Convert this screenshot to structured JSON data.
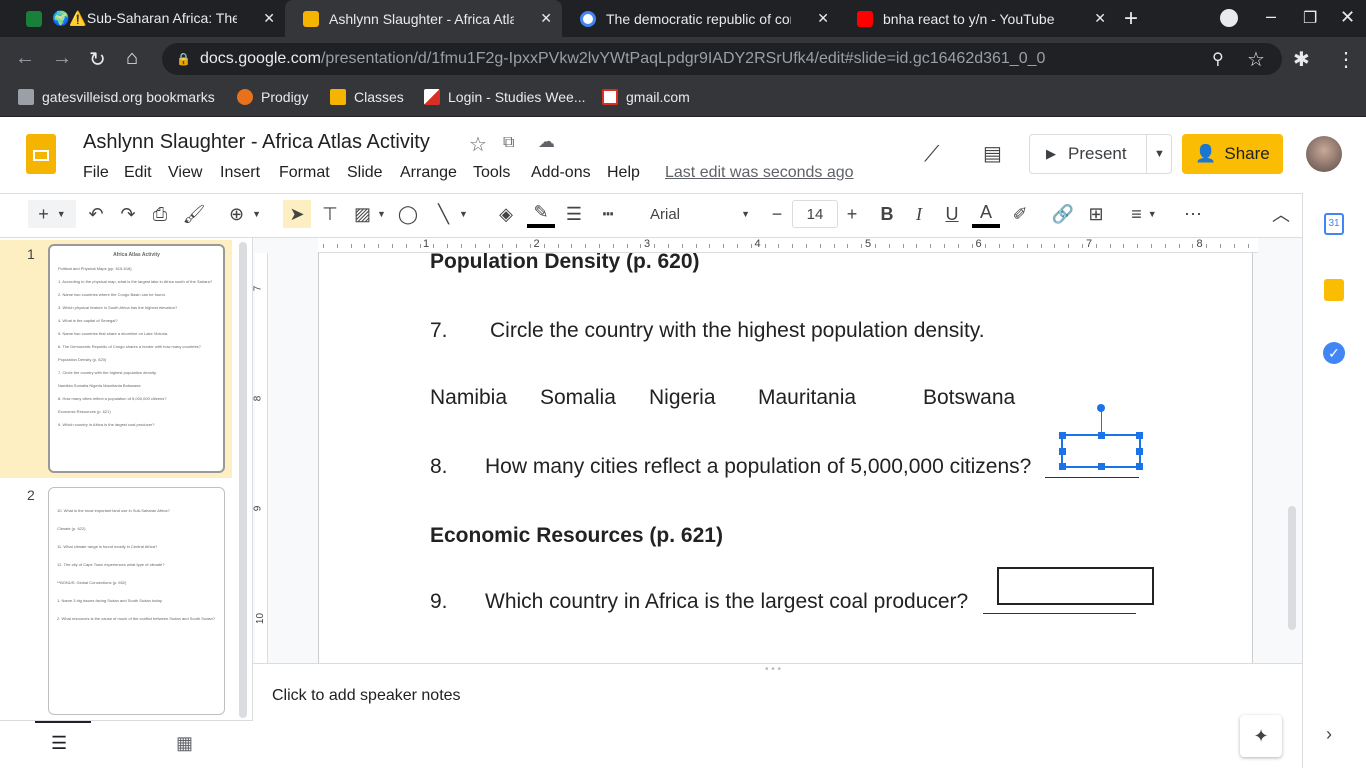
{
  "browser": {
    "tabs": [
      {
        "title": "🌍⚠️Sub-Saharan Africa: Thematic",
        "favicon_color": "#188038"
      },
      {
        "title": "Ashlynn Slaughter - Africa Atlas Activity",
        "favicon_color": "#f4b400",
        "active": true
      },
      {
        "title": "The democratic republic of congo",
        "favicon_color": "#4285f4"
      },
      {
        "title": "bnha react to y/n - YouTube",
        "favicon_color": "#ff0000"
      }
    ],
    "url_host": "docs.google.com",
    "url_path": "/presentation/d/1fmu1F2g-IpxxPVkw2lvYWtPaqLpdgr9IADY2RSrUfk4/edit#slide=id.gc16462d361_0_0",
    "bookmarks": [
      "gatesvilleisd.org bookmarks",
      "Prodigy",
      "Classes",
      "Login - Studies Wee...",
      "gmail.com"
    ]
  },
  "app": {
    "title": "Ashlynn Slaughter - Africa Atlas Activity",
    "menu": [
      "File",
      "Edit",
      "View",
      "Insert",
      "Format",
      "Slide",
      "Arrange",
      "Tools",
      "Add-ons",
      "Help"
    ],
    "last_edit": "Last edit was seconds ago",
    "present_label": "Present",
    "share_label": "Share",
    "font": "Arial",
    "font_size": "14"
  },
  "filmstrip": {
    "slides": [
      {
        "number": "1",
        "lines": [
          "Africa Atlas Activity",
          "Political and Physical Maps (pp. 615-618)",
          "1. According to the physical map, what is the largest lake in Africa south of the Sahara?",
          "2. Name two countries where the Congo Basin can be found.",
          "3. Which physical feature in South Africa has the highest elevation?",
          "4. What is the capital of Senegal?",
          "5. Name two countries that share a shoreline on Lake Victoria.",
          "6. The Democratic Republic of Congo shares a border with how many countries?",
          "Population Density (p. 620)",
          "7. Circle the country with the highest population density.",
          "Namibia  Somalia  Nigeria  Mauritania  Botswana",
          "8. How many cities reflect a population of 5,000,000 citizens?",
          "Economic Resources (p. 621)",
          "9. Which country in Africa is the largest coal producer?"
        ]
      },
      {
        "number": "2",
        "lines": [
          "10. What is the most important land use in Sub-Saharan Africa?",
          "Climate (p. 622)",
          "11. What climate range is found mostly in Central Africa?",
          "12. The city of Cape Town experiences what type of climate?",
          "**BONUS: Global Connections (p. 652)",
          "1. Name 3 big issues facing Sudan and South Sudan today.",
          "2. What resources is the cause of much of the conflict between Sudan and South Sudan?"
        ]
      }
    ]
  },
  "ruler": {
    "h": [
      "1",
      "2",
      "3",
      "4",
      "5",
      "6",
      "7",
      "8"
    ],
    "v": [
      "7",
      "8",
      "9",
      "10"
    ]
  },
  "slide": {
    "heading1": "Population Density (p. 620)",
    "q7_num": "7.",
    "q7_text": "Circle the country with the highest population density.",
    "countries": [
      "Namibia",
      "Somalia",
      "Nigeria",
      "Mauritania",
      "Botswana"
    ],
    "q8_num": "8.",
    "q8_text": "How many cities reflect a population of 5,000,000 citizens?",
    "heading2": "Economic Resources (p. 621)",
    "q9_num": "9.",
    "q9_text": "Which country in Africa is the largest coal producer?"
  },
  "notes": {
    "placeholder": "Click to add speaker notes"
  }
}
